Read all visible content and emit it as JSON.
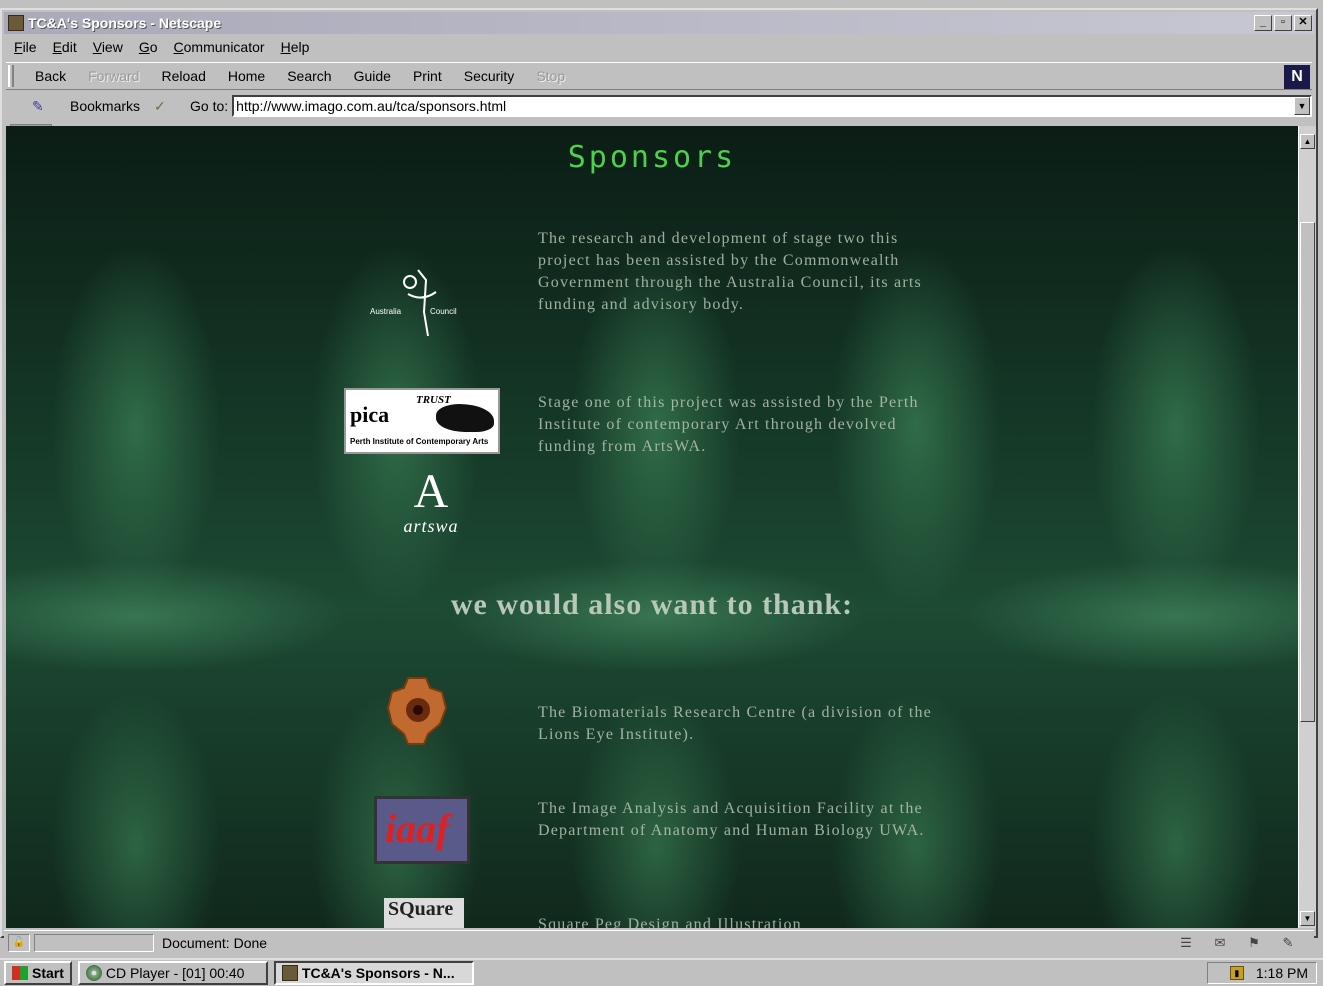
{
  "window": {
    "title": "TC&A's Sponsors - Netscape",
    "controls": {
      "minimize": "_",
      "maximize": "▫",
      "close": "✕"
    }
  },
  "menu": [
    "File",
    "Edit",
    "View",
    "Go",
    "Communicator",
    "Help"
  ],
  "nav_buttons": [
    {
      "label": "Back",
      "enabled": true
    },
    {
      "label": "Forward",
      "enabled": false
    },
    {
      "label": "Reload",
      "enabled": true
    },
    {
      "label": "Home",
      "enabled": true
    },
    {
      "label": "Search",
      "enabled": true
    },
    {
      "label": "Guide",
      "enabled": true
    },
    {
      "label": "Print",
      "enabled": true
    },
    {
      "label": "Security",
      "enabled": true
    },
    {
      "label": "Stop",
      "enabled": false
    }
  ],
  "location": {
    "bookmarks_label": "Bookmarks",
    "goto_label": "Go to:",
    "url": "http://www.imago.com.au/tca/sponsors.html"
  },
  "page": {
    "title": "Sponsors",
    "sponsors": [
      {
        "logo": "australia-council-logo",
        "text": "The research and development of stage two this project has been assisted by the Commonwealth Government through the Australia Council, its arts funding and advisory body."
      },
      {
        "logo": "pica-logo",
        "logo_text": "pica",
        "logo_trust": "TRUST",
        "logo_sub": "Perth Institute of Contemporary Arts",
        "text": "Stage one of this project was assisted by the Perth Institute of contemporary Art through devolved funding from ArtsWA."
      },
      {
        "logo": "artswa-logo",
        "logo_text": "artswa"
      }
    ],
    "thanks_heading": "we would also want to thank:",
    "thanks": [
      {
        "logo": "gear-logo",
        "text": "The Biomaterials Research Centre (a division of the Lions Eye Institute)."
      },
      {
        "logo": "iaaf-logo",
        "logo_text": "iaaf",
        "text": "The Image Analysis and Acquisition Facility at the Department of Anatomy and Human Biology UWA."
      },
      {
        "logo": "square-peg-logo",
        "logo_text": "SQuare",
        "text": "Square Peg Design and Illustration"
      }
    ]
  },
  "status": {
    "text": "Document: Done"
  },
  "taskbar": {
    "start": "Start",
    "tasks": [
      {
        "label": "CD Player - [01] 00:40",
        "active": false
      },
      {
        "label": "TC&A's Sponsors - N...",
        "active": true
      }
    ],
    "clock": "1:18 PM"
  },
  "colors": {
    "title_green": "#4ed04e",
    "body_text": "#b9c7b3",
    "bg_dark": "#0b1d15"
  }
}
